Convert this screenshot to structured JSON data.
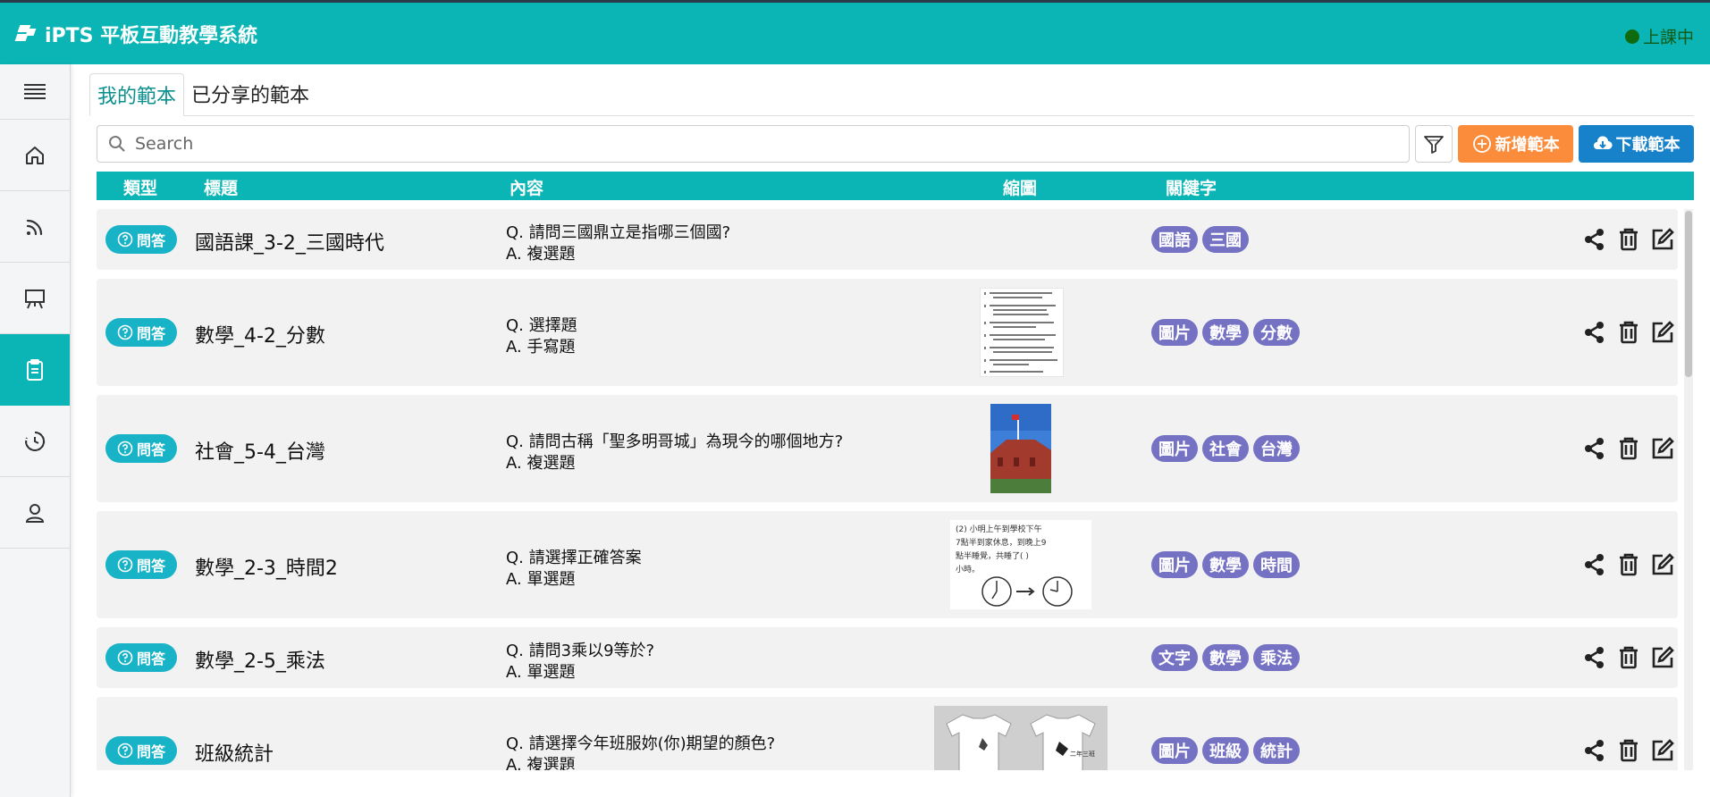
{
  "app": {
    "title": "iPTS 平板互動教學系統",
    "status": "上課中",
    "accent": "#0bb5b5",
    "status_color": "#106b10"
  },
  "sidebar": {
    "items": [
      {
        "icon": "menu-icon",
        "active": false
      },
      {
        "icon": "home-icon",
        "active": false
      },
      {
        "icon": "rss-icon",
        "active": false
      },
      {
        "icon": "easel-icon",
        "active": false
      },
      {
        "icon": "clipboard-icon",
        "active": true
      },
      {
        "icon": "history-icon",
        "active": false
      },
      {
        "icon": "user-icon",
        "active": false
      }
    ]
  },
  "tabs": [
    {
      "label": "我的範本",
      "active": true
    },
    {
      "label": "已分享的範本",
      "active": false
    }
  ],
  "toolbar": {
    "search_placeholder": "Search",
    "filter_icon": "filter-icon",
    "add_label": "新增範本",
    "add_color": "#fb8c3b",
    "download_label": "下載範本",
    "download_color": "#1781c9"
  },
  "table": {
    "headers": {
      "type": "類型",
      "title": "標題",
      "content": "內容",
      "thumb": "縮圖",
      "keywords": "關鍵字"
    },
    "rows": [
      {
        "type": "問答",
        "title": "國語課_3-2_三國時代",
        "q": "Q. 請問三國鼎立是指哪三個國?",
        "a": "A. 複選題",
        "thumb": "none",
        "tags": [
          "國語",
          "三國"
        ]
      },
      {
        "type": "問答",
        "title": "數學_4-2_分數",
        "q": "Q. 選擇題",
        "a": "A. 手寫題",
        "thumb": "worksheet",
        "tags": [
          "圖片",
          "數學",
          "分數"
        ]
      },
      {
        "type": "問答",
        "title": "社會_5-4_台灣",
        "q": "Q. 請問古稱「聖多明哥城」為現今的哪個地方?",
        "a": "A. 複選題",
        "thumb": "fort-photo",
        "tags": [
          "圖片",
          "社會",
          "台灣"
        ]
      },
      {
        "type": "問答",
        "title": "數學_2-3_時間2",
        "q": "Q. 請選擇正確答案",
        "a": "A. 單選題",
        "thumb": "clocks",
        "tags": [
          "圖片",
          "數學",
          "時間"
        ]
      },
      {
        "type": "問答",
        "title": "數學_2-5_乘法",
        "q": "Q. 請問3乘以9等於?",
        "a": "A. 單選題",
        "thumb": "none",
        "tags": [
          "文字",
          "數學",
          "乘法"
        ]
      },
      {
        "type": "問答",
        "title": "班級統計",
        "q": "Q. 請選擇今年班服妳(你)期望的顏色?",
        "a": "A. 複選題",
        "thumb": "tshirts",
        "tags": [
          "圖片",
          "班級",
          "統計"
        ]
      }
    ],
    "thumb_text": {
      "clocks": [
        "(2) 小明上午到學校下午",
        "7點半到家休息，到晚上9",
        "點半睡覺，共睡了(  )",
        "小時。"
      ],
      "tshirt_label": "二年三班"
    },
    "tag_color": "#7572c4",
    "badge_color": "#19b3c8"
  }
}
